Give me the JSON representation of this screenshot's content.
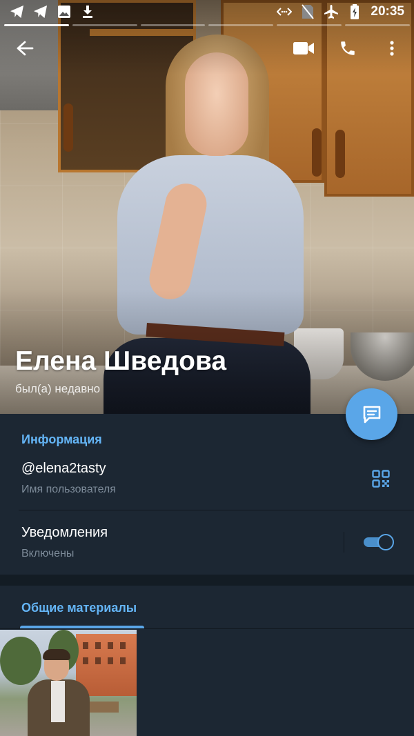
{
  "status_bar": {
    "time": "20:35",
    "left_icons": [
      "telegram-icon",
      "telegram-icon",
      "image-icon",
      "download-icon"
    ],
    "right_icons": [
      "data-saver-icon",
      "no-sim-icon",
      "airplane-icon",
      "battery-charging-icon"
    ]
  },
  "header": {
    "actions": [
      "back-arrow-icon",
      "video-call-icon",
      "phone-icon",
      "more-vert-icon"
    ],
    "story_segments": 6,
    "active_segment": 0
  },
  "profile": {
    "name": "Елена Шведова",
    "status": "был(а) недавно"
  },
  "info": {
    "title": "Информация",
    "username": "@elena2tasty",
    "username_label": "Имя пользователя",
    "notifications_title": "Уведомления",
    "notifications_state": "Включены",
    "notifications_enabled": true
  },
  "media": {
    "tab_label": "Общие материалы",
    "thumbnails": 1
  },
  "colors": {
    "background": "#1c2733",
    "accent": "#5aa6e8",
    "section_title": "#64b5f6",
    "secondary_text": "#7d8b99"
  }
}
